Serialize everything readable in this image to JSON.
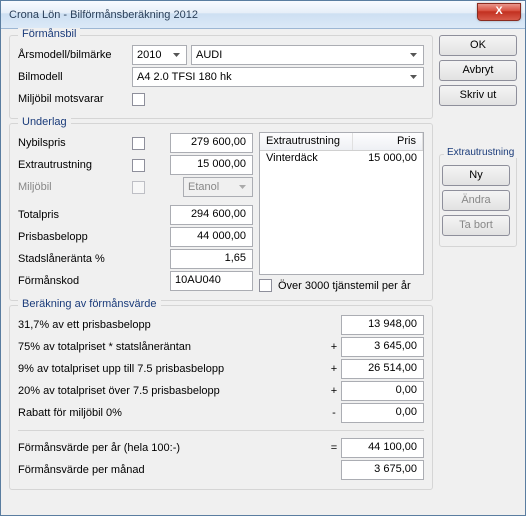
{
  "window": {
    "title": "Crona Lön - Bilförmånsberäkning 2012",
    "close": "X"
  },
  "buttons": {
    "ok": "OK",
    "avbryt": "Avbryt",
    "skriv_ut": "Skriv ut"
  },
  "formansbil": {
    "legend": "Förmånsbil",
    "arsmodell_label": "Årsmodell/bilmärke",
    "year": "2010",
    "make": "AUDI",
    "bilmodell_label": "Bilmodell",
    "model": "A4 2.0 TFSI 180 hk",
    "miljobil_label": "Miljöbil motsvarar"
  },
  "underlag": {
    "legend": "Underlag",
    "nybilspris_label": "Nybilspris",
    "nybilspris": "279 600,00",
    "extra_label": "Extrautrustning",
    "extra": "15 000,00",
    "miljobil_label": "Miljöbil",
    "miljobil_option": "Etanol",
    "total_label": "Totalpris",
    "total": "294 600,00",
    "prisbas_label": "Prisbasbelopp",
    "prisbas": "44 000,00",
    "ranta_label": "Stadslåneränta %",
    "ranta": "1,65",
    "kod_label": "Förmånskod",
    "kod": "10AU040",
    "table_head_name": "Extrautrustning",
    "table_head_price": "Pris",
    "table_row1_name": "Vinterdäck",
    "table_row1_price": "15 000,00",
    "tjanstmil": "Över 3000 tjänstemil per år"
  },
  "calc": {
    "legend": "Beräkning av förmånsvärde",
    "r1_desc": "31,7% av ett prisbasbelopp",
    "r1_val": "13 948,00",
    "r2_desc": "75% av totalpriset * statslåneräntan",
    "r2_op": "+",
    "r2_val": "3 645,00",
    "r3_desc": "9% av totalpriset upp till 7.5 prisbasbelopp",
    "r3_op": "+",
    "r3_val": "26 514,00",
    "r4_desc": "20% av totalpriset över 7.5 prisbasbelopp",
    "r4_op": "+",
    "r4_val": "0,00",
    "r5_desc": "Rabatt för miljöbil 0%",
    "r5_op": "-",
    "r5_val": "0,00",
    "r6_desc": "Förmånsvärde per år (hela 100:-)",
    "r6_op": "=",
    "r6_val": "44 100,00",
    "r7_desc": "Förmånsvärde per månad",
    "r7_val": "3 675,00"
  },
  "extragroup": {
    "legend": "Extrautrustning",
    "ny": "Ny",
    "andra": "Ändra",
    "tabort": "Ta bort"
  }
}
